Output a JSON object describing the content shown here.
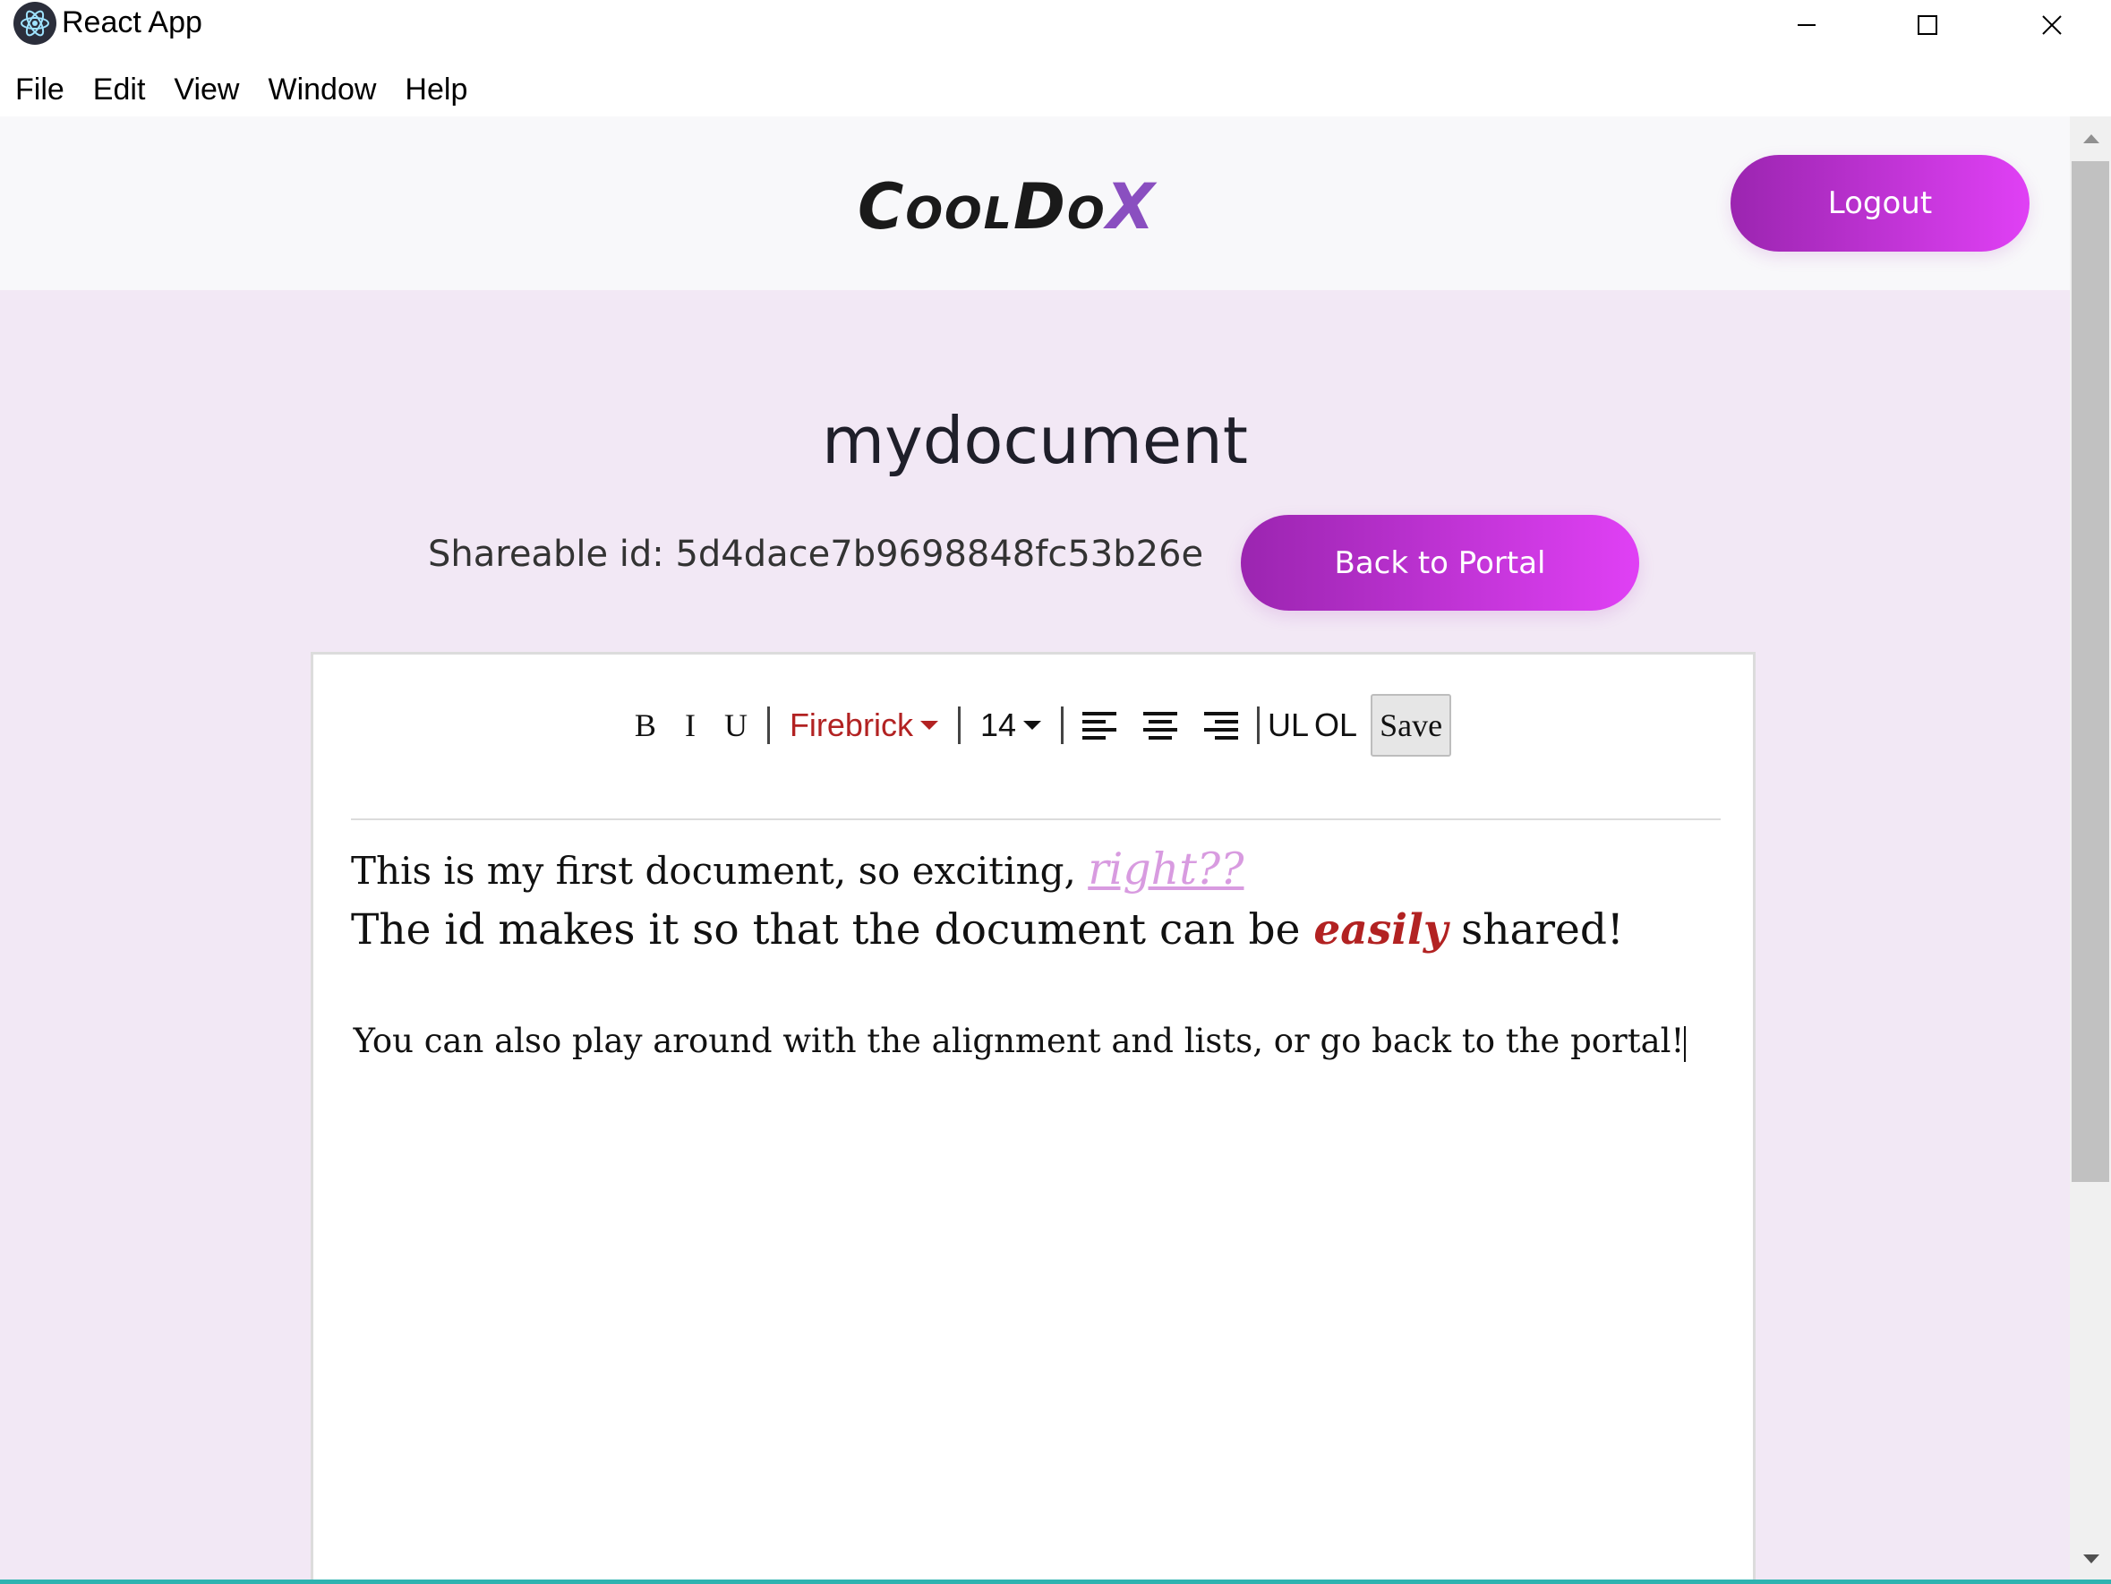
{
  "window": {
    "title": "React App",
    "controls": [
      "minimize-icon",
      "maximize-icon",
      "close-icon"
    ]
  },
  "menubar": {
    "items": [
      "File",
      "Edit",
      "View",
      "Window",
      "Help"
    ]
  },
  "header": {
    "logo_main": "CoolDo",
    "logo_x": "X",
    "logout_label": "Logout"
  },
  "document": {
    "title": "mydocument",
    "shareable_label": "Shareable id: 5d4dace7b9698848fc53b26e",
    "back_label": "Back to Portal"
  },
  "toolbar": {
    "bold": "B",
    "italic": "I",
    "underline": "U",
    "color_value": "Firebrick",
    "color_hex": "#b22222",
    "size_value": "14",
    "ul": "UL",
    "ol": "OL",
    "save": "Save"
  },
  "content": {
    "line1_text": "This is my first document, so exciting, ",
    "line1_accent": "right??",
    "line2_pre": "The id makes it so that the document can be ",
    "line2_emph": "easily",
    "line2_post": " shared!",
    "line3_text": "You can also play around with the alignment and lists, or go back to the portal!"
  },
  "colors": {
    "brand_gradient_start": "#9b25b0",
    "brand_gradient_end": "#e040f5",
    "page_bg": "#f2e8f5",
    "accent_text": "#d89be0"
  }
}
